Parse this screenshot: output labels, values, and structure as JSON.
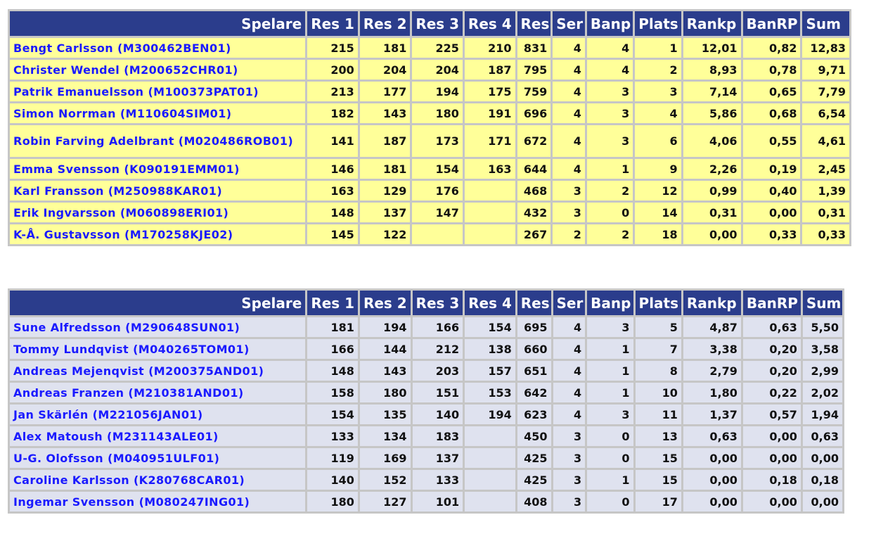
{
  "headers": [
    "Spelare",
    "Res 1",
    "Res 2",
    "Res 3",
    "Res 4",
    "Res",
    "Ser",
    "Banp",
    "Plats",
    "Rankp",
    "BanRP",
    "Sum"
  ],
  "colors": {
    "header_bg": "#2b3d8c",
    "table1_row_bg": "#ffff99",
    "table2_row_bg": "#dfe2ef",
    "name_link": "#1a1aff"
  },
  "tables": [
    {
      "rows": [
        [
          "Bengt Carlsson (M300462BEN01)",
          "215",
          "181",
          "225",
          "210",
          "831",
          "4",
          "4",
          "1",
          "12,01",
          "0,82",
          "12,83"
        ],
        [
          "Christer Wendel (M200652CHR01)",
          "200",
          "204",
          "204",
          "187",
          "795",
          "4",
          "4",
          "2",
          "8,93",
          "0,78",
          "9,71"
        ],
        [
          "Patrik Emanuelsson (M100373PAT01)",
          "213",
          "177",
          "194",
          "175",
          "759",
          "4",
          "3",
          "3",
          "7,14",
          "0,65",
          "7,79"
        ],
        [
          "Simon Norrman (M110604SIM01)",
          "182",
          "143",
          "180",
          "191",
          "696",
          "4",
          "3",
          "4",
          "5,86",
          "0,68",
          "6,54"
        ],
        [
          "Robin Farving Adelbrant (M020486ROB01)",
          "141",
          "187",
          "173",
          "171",
          "672",
          "4",
          "3",
          "6",
          "4,06",
          "0,55",
          "4,61"
        ],
        [
          "Emma Svensson (K090191EMM01)",
          "146",
          "181",
          "154",
          "163",
          "644",
          "4",
          "1",
          "9",
          "2,26",
          "0,19",
          "2,45"
        ],
        [
          "Karl Fransson (M250988KAR01)",
          "163",
          "129",
          "176",
          "",
          "468",
          "3",
          "2",
          "12",
          "0,99",
          "0,40",
          "1,39"
        ],
        [
          "Erik Ingvarsson (M060898ERI01)",
          "148",
          "137",
          "147",
          "",
          "432",
          "3",
          "0",
          "14",
          "0,31",
          "0,00",
          "0,31"
        ],
        [
          "K-Å. Gustavsson (M170258KJE02)",
          "145",
          "122",
          "",
          "",
          "267",
          "2",
          "2",
          "18",
          "0,00",
          "0,33",
          "0,33"
        ]
      ]
    },
    {
      "rows": [
        [
          "Sune Alfredsson (M290648SUN01)",
          "181",
          "194",
          "166",
          "154",
          "695",
          "4",
          "3",
          "5",
          "4,87",
          "0,63",
          "5,50"
        ],
        [
          "Tommy Lundqvist (M040265TOM01)",
          "166",
          "144",
          "212",
          "138",
          "660",
          "4",
          "1",
          "7",
          "3,38",
          "0,20",
          "3,58"
        ],
        [
          "Andreas Mejenqvist (M200375AND01)",
          "148",
          "143",
          "203",
          "157",
          "651",
          "4",
          "1",
          "8",
          "2,79",
          "0,20",
          "2,99"
        ],
        [
          "Andreas Franzen (M210381AND01)",
          "158",
          "180",
          "151",
          "153",
          "642",
          "4",
          "1",
          "10",
          "1,80",
          "0,22",
          "2,02"
        ],
        [
          "Jan Skärlén (M221056JAN01)",
          "154",
          "135",
          "140",
          "194",
          "623",
          "4",
          "3",
          "11",
          "1,37",
          "0,57",
          "1,94"
        ],
        [
          "Alex Matoush (M231143ALE01)",
          "133",
          "134",
          "183",
          "",
          "450",
          "3",
          "0",
          "13",
          "0,63",
          "0,00",
          "0,63"
        ],
        [
          "U-G. Olofsson (M040951ULF01)",
          "119",
          "169",
          "137",
          "",
          "425",
          "3",
          "0",
          "15",
          "0,00",
          "0,00",
          "0,00"
        ],
        [
          "Caroline Karlsson (K280768CAR01)",
          "140",
          "152",
          "133",
          "",
          "425",
          "3",
          "1",
          "15",
          "0,00",
          "0,18",
          "0,18"
        ],
        [
          "Ingemar Svensson (M080247ING01)",
          "180",
          "127",
          "101",
          "",
          "408",
          "3",
          "0",
          "17",
          "0,00",
          "0,00",
          "0,00"
        ]
      ]
    }
  ]
}
